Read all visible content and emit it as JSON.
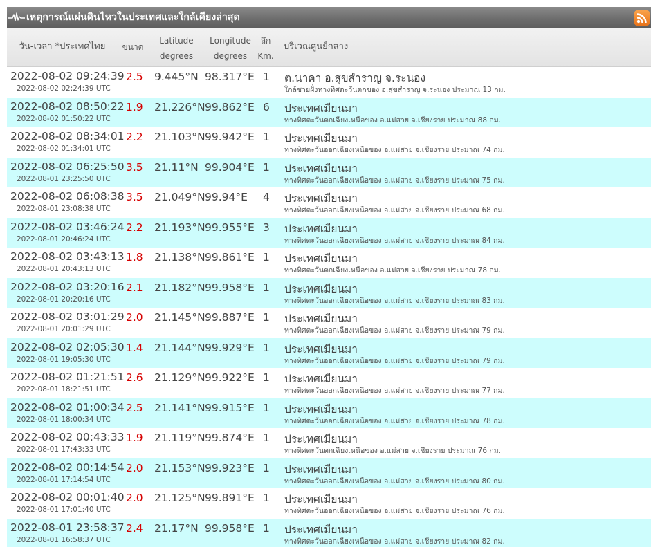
{
  "header": {
    "title": "เหตุการณ์แผ่นดินไหวในประเทศและใกล้เคียงล่าสุด"
  },
  "columns": {
    "time": "วัน-เวลา *ประเทศไทย",
    "magnitude": "ขนาด",
    "latitude_1": "Latitude",
    "latitude_2": "degrees",
    "longitude_1": "Longitude",
    "longitude_2": "degrees",
    "depth_1": "ลึก",
    "depth_2": "Km.",
    "area": "บริเวณศูนย์กลาง"
  },
  "colors": {
    "magnitude": "#d60000",
    "alt_row": "#cdfdfd",
    "titlebar": "#6e6e6e",
    "rss": "#e8731a"
  },
  "rows": [
    {
      "time": "2022-08-02 09:24:39",
      "utc": "2022-08-02 02:24:39 UTC",
      "mag": "2.5",
      "lat": "9.445°N",
      "lon": "98.317°E",
      "depth": "1",
      "place": "ต.นาคา อ.สุขสำราญ จ.ระนอง",
      "desc": "ใกล้ชายฝั่งทางทิศตะวันตกของ อ.สุขสำราญ จ.ระนอง ประมาณ 13 กม."
    },
    {
      "time": "2022-08-02 08:50:22",
      "utc": "2022-08-02 01:50:22 UTC",
      "mag": "1.9",
      "lat": "21.226°N",
      "lon": "99.862°E",
      "depth": "6",
      "place": "ประเทศเมียนมา",
      "desc": "ทางทิศตะวันตกเฉียงเหนือของ อ.แม่สาย จ.เชียงราย ประมาณ 88 กม."
    },
    {
      "time": "2022-08-02 08:34:01",
      "utc": "2022-08-02 01:34:01 UTC",
      "mag": "2.2",
      "lat": "21.103°N",
      "lon": "99.942°E",
      "depth": "1",
      "place": "ประเทศเมียนมา",
      "desc": "ทางทิศตะวันออกเฉียงเหนือของ อ.แม่สาย จ.เชียงราย ประมาณ 74 กม."
    },
    {
      "time": "2022-08-02 06:25:50",
      "utc": "2022-08-01 23:25:50 UTC",
      "mag": "3.5",
      "lat": "21.11°N",
      "lon": "99.904°E",
      "depth": "1",
      "place": "ประเทศเมียนมา",
      "desc": "ทางทิศตะวันออกเฉียงเหนือของ อ.แม่สาย จ.เชียงราย ประมาณ 75 กม."
    },
    {
      "time": "2022-08-02 06:08:38",
      "utc": "2022-08-01 23:08:38 UTC",
      "mag": "3.5",
      "lat": "21.049°N",
      "lon": "99.94°E",
      "depth": "4",
      "place": "ประเทศเมียนมา",
      "desc": "ทางทิศตะวันออกเฉียงเหนือของ อ.แม่สาย จ.เชียงราย ประมาณ 68 กม."
    },
    {
      "time": "2022-08-02 03:46:24",
      "utc": "2022-08-01 20:46:24 UTC",
      "mag": "2.2",
      "lat": "21.193°N",
      "lon": "99.955°E",
      "depth": "3",
      "place": "ประเทศเมียนมา",
      "desc": "ทางทิศตะวันออกเฉียงเหนือของ อ.แม่สาย จ.เชียงราย ประมาณ 84 กม."
    },
    {
      "time": "2022-08-02 03:43:13",
      "utc": "2022-08-01 20:43:13 UTC",
      "mag": "1.8",
      "lat": "21.138°N",
      "lon": "99.861°E",
      "depth": "1",
      "place": "ประเทศเมียนมา",
      "desc": "ทางทิศตะวันตกเฉียงเหนือของ อ.แม่สาย จ.เชียงราย ประมาณ 78 กม."
    },
    {
      "time": "2022-08-02 03:20:16",
      "utc": "2022-08-01 20:20:16 UTC",
      "mag": "2.1",
      "lat": "21.182°N",
      "lon": "99.958°E",
      "depth": "1",
      "place": "ประเทศเมียนมา",
      "desc": "ทางทิศตะวันออกเฉียงเหนือของ อ.แม่สาย จ.เชียงราย ประมาณ 83 กม."
    },
    {
      "time": "2022-08-02 03:01:29",
      "utc": "2022-08-01 20:01:29 UTC",
      "mag": "2.0",
      "lat": "21.145°N",
      "lon": "99.887°E",
      "depth": "1",
      "place": "ประเทศเมียนมา",
      "desc": "ทางทิศตะวันออกเฉียงเหนือของ อ.แม่สาย จ.เชียงราย ประมาณ 79 กม."
    },
    {
      "time": "2022-08-02 02:05:30",
      "utc": "2022-08-01 19:05:30 UTC",
      "mag": "1.4",
      "lat": "21.144°N",
      "lon": "99.929°E",
      "depth": "1",
      "place": "ประเทศเมียนมา",
      "desc": "ทางทิศตะวันออกเฉียงเหนือของ อ.แม่สาย จ.เชียงราย ประมาณ 79 กม."
    },
    {
      "time": "2022-08-02 01:21:51",
      "utc": "2022-08-01 18:21:51 UTC",
      "mag": "2.6",
      "lat": "21.129°N",
      "lon": "99.922°E",
      "depth": "1",
      "place": "ประเทศเมียนมา",
      "desc": "ทางทิศตะวันออกเฉียงเหนือของ อ.แม่สาย จ.เชียงราย ประมาณ 77 กม."
    },
    {
      "time": "2022-08-02 01:00:34",
      "utc": "2022-08-01 18:00:34 UTC",
      "mag": "2.5",
      "lat": "21.141°N",
      "lon": "99.915°E",
      "depth": "1",
      "place": "ประเทศเมียนมา",
      "desc": "ทางทิศตะวันออกเฉียงเหนือของ อ.แม่สาย จ.เชียงราย ประมาณ 78 กม."
    },
    {
      "time": "2022-08-02 00:43:33",
      "utc": "2022-08-01 17:43:33 UTC",
      "mag": "1.9",
      "lat": "21.119°N",
      "lon": "99.874°E",
      "depth": "1",
      "place": "ประเทศเมียนมา",
      "desc": "ทางทิศตะวันตกเฉียงเหนือของ อ.แม่สาย จ.เชียงราย ประมาณ 76 กม."
    },
    {
      "time": "2022-08-02 00:14:54",
      "utc": "2022-08-01 17:14:54 UTC",
      "mag": "2.0",
      "lat": "21.153°N",
      "lon": "99.923°E",
      "depth": "1",
      "place": "ประเทศเมียนมา",
      "desc": "ทางทิศตะวันออกเฉียงเหนือของ อ.แม่สาย จ.เชียงราย ประมาณ 80 กม."
    },
    {
      "time": "2022-08-02 00:01:40",
      "utc": "2022-08-01 17:01:40 UTC",
      "mag": "2.0",
      "lat": "21.125°N",
      "lon": "99.891°E",
      "depth": "1",
      "place": "ประเทศเมียนมา",
      "desc": "ทางทิศตะวันออกเฉียงเหนือของ อ.แม่สาย จ.เชียงราย ประมาณ 76 กม."
    },
    {
      "time": "2022-08-01 23:58:37",
      "utc": "2022-08-01 16:58:37 UTC",
      "mag": "2.4",
      "lat": "21.17°N",
      "lon": "99.958°E",
      "depth": "1",
      "place": "ประเทศเมียนมา",
      "desc": "ทางทิศตะวันออกเฉียงเหนือของ อ.แม่สาย จ.เชียงราย ประมาณ 82 กม."
    }
  ]
}
